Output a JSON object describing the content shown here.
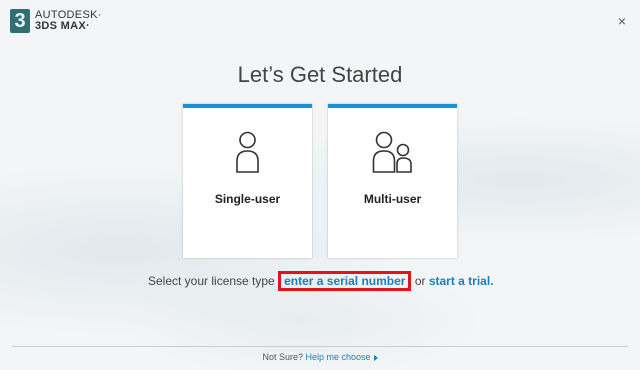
{
  "header": {
    "logo_mark": "3",
    "brand_line1": "AUTODESK·",
    "brand_line2": "3DS MAX·",
    "close_label": "×"
  },
  "main": {
    "title": "Let’s Get Started",
    "cards": [
      {
        "label": "Single-user",
        "icon": "single-user-icon"
      },
      {
        "label": "Multi-user",
        "icon": "multi-user-icon"
      }
    ],
    "license_prefix": "Select your license type",
    "serial_link": "enter a serial number",
    "or_text": "or",
    "trial_link": "start a trial",
    "period": "."
  },
  "footer": {
    "not_sure": "Not Sure?",
    "help_link": "Help me choose"
  },
  "colors": {
    "accent": "#1b8fd3",
    "link": "#1b7fbf",
    "highlight": "#e0141d"
  }
}
